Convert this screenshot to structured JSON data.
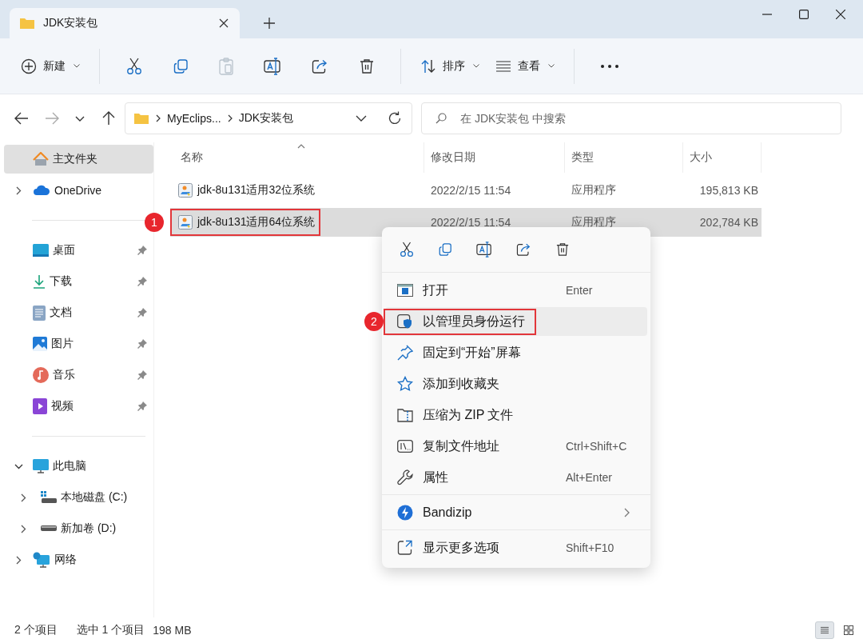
{
  "window": {
    "tab_title": "JDK安装包"
  },
  "toolbar": {
    "new_label": "新建",
    "sort_label": "排序",
    "view_label": "查看"
  },
  "address": {
    "path": [
      "MyEclips...",
      "JDK安装包"
    ],
    "search_placeholder": "在 JDK安装包 中搜索"
  },
  "sidebar": {
    "groups": [
      {
        "items": [
          {
            "label": "主文件夹",
            "kind": "home",
            "selected": true
          },
          {
            "label": "OneDrive",
            "kind": "cloud",
            "selected": false,
            "expanded": false
          }
        ]
      },
      {
        "items": [
          {
            "label": "桌面",
            "kind": "desktop",
            "selected": false,
            "pinned": true
          },
          {
            "label": "下载",
            "kind": "download",
            "selected": false,
            "pinned": true
          },
          {
            "label": "文档",
            "kind": "documents",
            "selected": false,
            "pinned": true
          },
          {
            "label": "图片",
            "kind": "pictures",
            "selected": false,
            "pinned": true
          },
          {
            "label": "音乐",
            "kind": "music",
            "selected": false,
            "pinned": true
          },
          {
            "label": "视频",
            "kind": "videos",
            "selected": false,
            "pinned": true
          }
        ]
      },
      {
        "items": [
          {
            "label": "此电脑",
            "kind": "pc",
            "selected": false,
            "expanded": true,
            "children": [
              {
                "label": "本地磁盘 (C:)",
                "kind": "system-drive",
                "selected": false,
                "expanded": false
              },
              {
                "label": "新加卷 (D:)",
                "kind": "drive",
                "selected": false,
                "expanded": false
              }
            ]
          },
          {
            "label": "网络",
            "kind": "network",
            "selected": false,
            "expanded": false
          }
        ]
      }
    ]
  },
  "table": {
    "columns": [
      {
        "label": "名称",
        "sorted": true
      },
      {
        "label": "修改日期",
        "sorted": false
      },
      {
        "label": "类型",
        "sorted": false
      },
      {
        "label": "大小",
        "sorted": false
      }
    ],
    "rows": [
      {
        "name": "jdk-8u131适用32位系统",
        "date": "2022/2/15 11:54",
        "type": "应用程序",
        "size": "195,813 KB",
        "selected": false,
        "outlined": false
      },
      {
        "name": "jdk-8u131适用64位系统",
        "date": "2022/2/15 11:54",
        "type": "应用程序",
        "size": "202,784 KB",
        "selected": true,
        "outlined": true,
        "badge": "1"
      }
    ]
  },
  "context_menu": {
    "sections": [
      {
        "items": [
          {
            "label": "打开",
            "kind": "open",
            "shortcut": "Enter",
            "selected": false,
            "outlined": false
          },
          {
            "label": "以管理员身份运行",
            "kind": "admin",
            "selected": true,
            "outlined": true,
            "badge": "2"
          },
          {
            "label": "固定到“开始”屏幕",
            "kind": "pin",
            "selected": false,
            "outlined": false
          },
          {
            "label": "添加到收藏夹",
            "kind": "star",
            "selected": false,
            "outlined": false
          },
          {
            "label": "压缩为 ZIP 文件",
            "kind": "zip",
            "selected": false,
            "outlined": false
          },
          {
            "label": "复制文件地址",
            "kind": "path",
            "shortcut": "Ctrl+Shift+C",
            "selected": false,
            "outlined": false
          },
          {
            "label": "属性",
            "kind": "wrench",
            "shortcut": "Alt+Enter",
            "selected": false,
            "outlined": false
          }
        ]
      },
      {
        "items": [
          {
            "label": "Bandizip",
            "kind": "bandizip",
            "selected": false,
            "outlined": false,
            "submenu": true
          }
        ]
      },
      {
        "items": [
          {
            "label": "显示更多选项",
            "kind": "more",
            "shortcut": "Shift+F10",
            "selected": false,
            "outlined": false
          }
        ]
      }
    ]
  },
  "status_bar": {
    "item_count": "2 个项目",
    "selection": "选中 1 个项目",
    "selection_size": "198 MB",
    "views": [
      {
        "kind": "details",
        "selected": true
      },
      {
        "kind": "tiles",
        "selected": false
      }
    ]
  }
}
